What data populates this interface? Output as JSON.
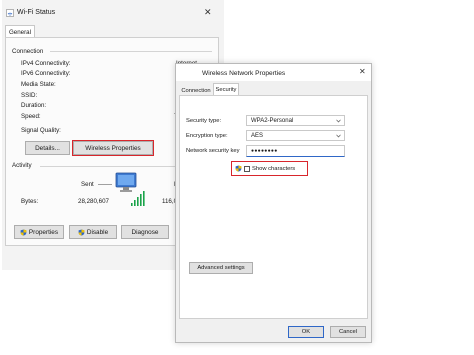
{
  "wifi_window": {
    "title": "Wi-Fi Status",
    "tab": "General",
    "connection_heading": "Connection",
    "rows": [
      {
        "label": "IPv4 Connectivity:",
        "value": "Internet"
      },
      {
        "label": "IPv6 Connectivity:",
        "value": ""
      },
      {
        "label": "Media State:",
        "value": "E"
      },
      {
        "label": "SSID:",
        "value": ""
      },
      {
        "label": "Duration:",
        "value": "0"
      },
      {
        "label": "Speed:",
        "value": "72"
      }
    ],
    "signal_quality_label": "Signal Quality:",
    "details_button": "Details...",
    "wireless_properties_button": "Wireless Properties",
    "activity_heading": "Activity",
    "sent_label": "Sent",
    "received_label": "R",
    "bytes_label": "Bytes:",
    "bytes_sent": "28,280,607",
    "bytes_received": "116,0",
    "properties_button": "Properties",
    "disable_button": "Disable",
    "diagnose_button": "Diagnose",
    "close_glyph": "✕"
  },
  "wireless_window": {
    "title": "Wireless Network Properties",
    "close_glyph": "✕",
    "tabs": [
      "Connection",
      "Security"
    ],
    "active_tab": "Security",
    "security_type_label": "Security type:",
    "security_type_value": "WPA2-Personal",
    "encryption_type_label": "Encryption type:",
    "encryption_type_value": "AES",
    "network_key_label": "Network security key",
    "network_key_value": "●●●●●●●●",
    "show_characters_label": "Show characters",
    "advanced_button": "Advanced settings",
    "ok_button": "OK",
    "cancel_button": "Cancel"
  },
  "colors": {
    "highlight": "#d8262c",
    "signal_bars": "#1aa34a",
    "shield_blue": "#2f67c7",
    "shield_yellow": "#f2c300"
  }
}
